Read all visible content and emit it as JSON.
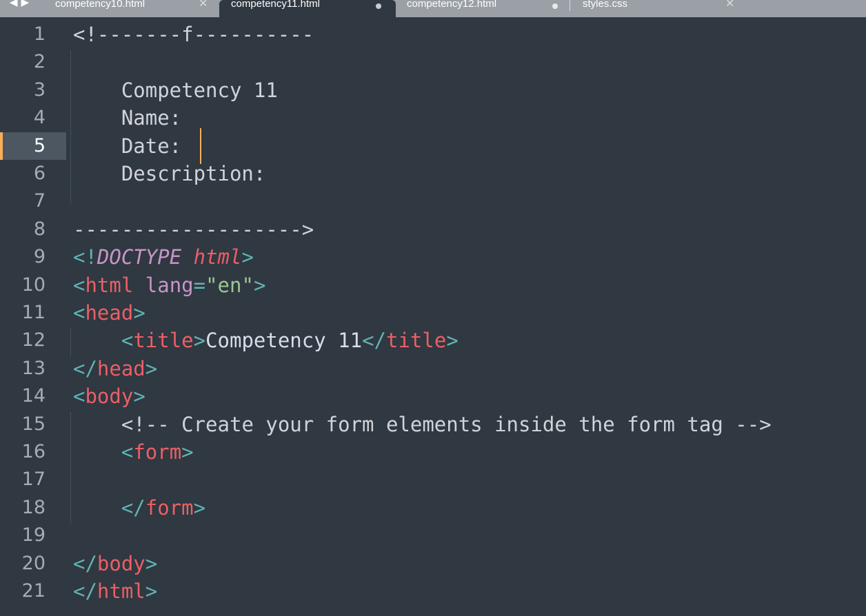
{
  "tabs": [
    {
      "label": "competency10.html",
      "state": "close"
    },
    {
      "label": "competency11.html",
      "state": "modified",
      "active": true
    },
    {
      "label": "competency12.html",
      "state": "modified"
    },
    {
      "label": "styles.css",
      "state": "close"
    }
  ],
  "editor": {
    "current_line": 5,
    "lines": [
      {
        "n": "1",
        "text": "<!-------f----------"
      },
      {
        "n": "2",
        "text": ""
      },
      {
        "n": "3",
        "text": "    Competency 11"
      },
      {
        "n": "4",
        "text": "    Name:"
      },
      {
        "n": "5",
        "text": "    Date: "
      },
      {
        "n": "6",
        "text": "    Description:"
      },
      {
        "n": "7",
        "text": ""
      },
      {
        "n": "8",
        "text": "------------------->"
      },
      {
        "n": "9",
        "tokens": [
          [
            "punct",
            "<!"
          ],
          [
            "doctype",
            "DOCTYPE"
          ],
          [
            "text",
            " "
          ],
          [
            "html-it",
            "html"
          ],
          [
            "punct",
            ">"
          ]
        ]
      },
      {
        "n": "10",
        "tokens": [
          [
            "punct",
            "<"
          ],
          [
            "tag",
            "html"
          ],
          [
            "text",
            " "
          ],
          [
            "attr",
            "lang"
          ],
          [
            "punct",
            "="
          ],
          [
            "str",
            "\"en\""
          ],
          [
            "punct",
            ">"
          ]
        ]
      },
      {
        "n": "11",
        "tokens": [
          [
            "punct",
            "<"
          ],
          [
            "tag",
            "head"
          ],
          [
            "punct",
            ">"
          ]
        ]
      },
      {
        "n": "12",
        "tokens": [
          [
            "text",
            "    "
          ],
          [
            "punct",
            "<"
          ],
          [
            "tag",
            "title"
          ],
          [
            "punct",
            ">"
          ],
          [
            "text",
            "Competency 11"
          ],
          [
            "punct",
            "</"
          ],
          [
            "tag",
            "title"
          ],
          [
            "punct",
            ">"
          ]
        ]
      },
      {
        "n": "13",
        "tokens": [
          [
            "punct",
            "</"
          ],
          [
            "tag",
            "head"
          ],
          [
            "punct",
            ">"
          ]
        ]
      },
      {
        "n": "14",
        "tokens": [
          [
            "punct",
            "<"
          ],
          [
            "tag",
            "body"
          ],
          [
            "punct",
            ">"
          ]
        ]
      },
      {
        "n": "15",
        "tokens": [
          [
            "text",
            "    "
          ],
          [
            "comment",
            "<!-- Create your form elements inside the form tag -->"
          ]
        ]
      },
      {
        "n": "16",
        "tokens": [
          [
            "text",
            "    "
          ],
          [
            "punct",
            "<"
          ],
          [
            "tag",
            "form"
          ],
          [
            "punct",
            ">"
          ]
        ]
      },
      {
        "n": "17",
        "tokens": []
      },
      {
        "n": "18",
        "tokens": [
          [
            "text",
            "    "
          ],
          [
            "punct",
            "</"
          ],
          [
            "tag",
            "form"
          ],
          [
            "punct",
            ">"
          ]
        ]
      },
      {
        "n": "19",
        "tokens": []
      },
      {
        "n": "20",
        "tokens": [
          [
            "punct",
            "</"
          ],
          [
            "tag",
            "body"
          ],
          [
            "punct",
            ">"
          ]
        ]
      },
      {
        "n": "21",
        "tokens": [
          [
            "punct",
            "</"
          ],
          [
            "tag",
            "html"
          ],
          [
            "punct",
            ">"
          ]
        ]
      }
    ]
  },
  "colors": {
    "background": "#303841",
    "accent": "#f9ae58",
    "tag": "#ec5f66",
    "punct": "#5fb4b4",
    "attr": "#c695c6",
    "string": "#99c794"
  }
}
